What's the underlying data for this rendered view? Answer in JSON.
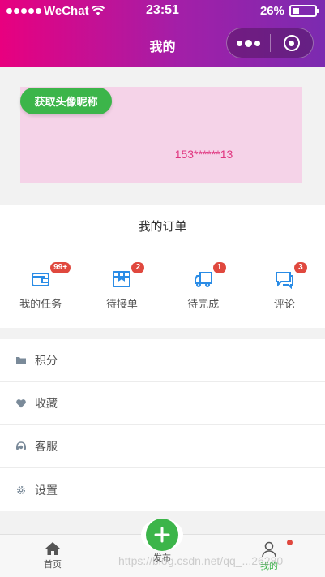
{
  "status_bar": {
    "carrier": "WeChat",
    "time": "23:51",
    "battery": "26%"
  },
  "nav": {
    "title": "我的"
  },
  "profile": {
    "avatar_button": "获取头像昵称",
    "phone": "153******13"
  },
  "orders": {
    "title": "我的订单",
    "items": [
      {
        "label": "我的任务",
        "badge": "99+",
        "icon": "wallet-icon"
      },
      {
        "label": "待接单",
        "badge": "2",
        "icon": "box-icon"
      },
      {
        "label": "待完成",
        "badge": "1",
        "icon": "truck-icon"
      },
      {
        "label": "评论",
        "badge": "3",
        "icon": "chat-icon"
      }
    ]
  },
  "menu": {
    "items": [
      {
        "label": "积分",
        "icon": "folder-icon"
      },
      {
        "label": "收藏",
        "icon": "heart-icon"
      },
      {
        "label": "客服",
        "icon": "headset-icon"
      },
      {
        "label": "设置",
        "icon": "gear-icon"
      }
    ]
  },
  "tabbar": {
    "home": "首页",
    "publish": "发布",
    "mine": "我的"
  },
  "watermark": "https://blog.csdn.net/qq_...26280",
  "colors": {
    "accent": "#3cb54a",
    "badge": "#e0483e",
    "header_start": "#e8007f",
    "header_end": "#7b2bb0",
    "phone": "#e0357f"
  }
}
